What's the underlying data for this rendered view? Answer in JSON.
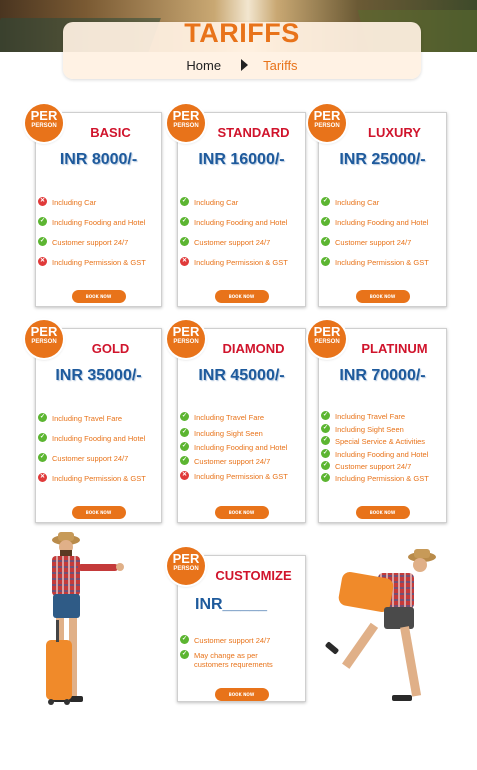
{
  "page": {
    "title": "TARIFFS"
  },
  "breadcrumb": {
    "home": "Home",
    "current": "Tariffs"
  },
  "badge": {
    "line1": "PER",
    "line2": "PERSON"
  },
  "book_label": "BOOK NOW",
  "colors": {
    "accent": "#e8731a",
    "title_red": "#d0142c",
    "price_blue": "#1e5a9c",
    "check_green": "#5cb531",
    "cross_red": "#e03a3a"
  },
  "plans": [
    {
      "name": "BASIC",
      "price": "INR 8000/-",
      "features": [
        {
          "text": "Including Car",
          "included": false
        },
        {
          "text": "Including Fooding and Hotel",
          "included": true
        },
        {
          "text": "Customer support 24/7",
          "included": true
        },
        {
          "text": "Including Permission & GST",
          "included": false
        }
      ]
    },
    {
      "name": "STANDARD",
      "price": "INR 16000/-",
      "features": [
        {
          "text": "Including Car",
          "included": true
        },
        {
          "text": "Including Fooding and Hotel",
          "included": true
        },
        {
          "text": "Customer support 24/7",
          "included": true
        },
        {
          "text": "Including Permission & GST",
          "included": false
        }
      ]
    },
    {
      "name": "LUXURY",
      "price": "INR 25000/-",
      "features": [
        {
          "text": "Including Car",
          "included": true
        },
        {
          "text": "Including Fooding and Hotel",
          "included": true
        },
        {
          "text": "Customer support 24/7",
          "included": true
        },
        {
          "text": "Including Permission & GST",
          "included": true
        }
      ]
    },
    {
      "name": "GOLD",
      "price": "INR 35000/-",
      "features": [
        {
          "text": "Including Travel Fare",
          "included": true
        },
        {
          "text": "Including Fooding and Hotel",
          "included": true
        },
        {
          "text": "Customer support 24/7",
          "included": true
        },
        {
          "text": "Including Permission & GST",
          "included": false
        }
      ]
    },
    {
      "name": "DIAMOND",
      "price": "INR 45000/-",
      "features": [
        {
          "text": "Including Travel Fare",
          "included": true
        },
        {
          "text": "Including Sight Seen",
          "included": true
        },
        {
          "text": "Including Fooding and Hotel",
          "included": true
        },
        {
          "text": "Customer support 24/7",
          "included": true
        },
        {
          "text": "Including Permission & GST",
          "included": false
        }
      ]
    },
    {
      "name": "PLATINUM",
      "price": "INR 70000/-",
      "features": [
        {
          "text": "Including Travel Fare",
          "included": true
        },
        {
          "text": "Including Sight Seen",
          "included": true
        },
        {
          "text": "Special Service & Activities",
          "included": true
        },
        {
          "text": "Including Fooding and Hotel",
          "included": true
        },
        {
          "text": "Customer support 24/7",
          "included": true
        },
        {
          "text": "Including Permission & GST",
          "included": true
        }
      ]
    },
    {
      "name": "CUSTOMIZE",
      "price": "INR_____",
      "features": [
        {
          "text": "Customer support 24/7",
          "included": true
        },
        {
          "text": "May change as per customers requrements",
          "included": true
        }
      ]
    }
  ]
}
